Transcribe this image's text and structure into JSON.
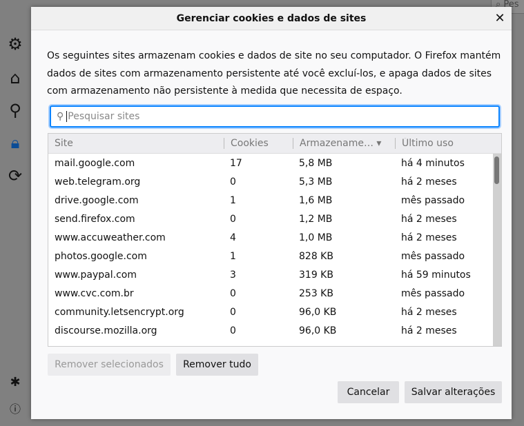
{
  "background": {
    "search_placeholder": "Pes"
  },
  "sidebar": {
    "icons": [
      "gear-icon",
      "home-icon",
      "search-icon",
      "lock-icon",
      "sync-icon",
      "puzzle-icon",
      "help-icon"
    ]
  },
  "dialog": {
    "title": "Gerenciar cookies e dados de sites",
    "close_label": "✕",
    "description": "Os seguintes sites armazenam cookies e dados de site no seu computador. O Firefox mantém dados de sites com armazenamento persistente até você excluí-los, e apaga dados de sites com armazenamento não persistente à medida que necessita de espaço.",
    "search": {
      "placeholder": "Pesquisar sites",
      "value": ""
    },
    "columns": [
      "Site",
      "Cookies",
      "Armazename…",
      "Último uso"
    ],
    "sort_indicator": "▾",
    "rows": [
      [
        "mail.google.com",
        "17",
        "5,8 MB",
        "há 4 minutos"
      ],
      [
        "web.telegram.org",
        "0",
        "5,3 MB",
        "há 2 meses"
      ],
      [
        "drive.google.com",
        "1",
        "1,6 MB",
        "mês passado"
      ],
      [
        "send.firefox.com",
        "0",
        "1,2 MB",
        "há 2 meses"
      ],
      [
        "www.accuweather.com",
        "4",
        "1,0 MB",
        "há 2 meses"
      ],
      [
        "photos.google.com",
        "1",
        "828 KB",
        "mês passado"
      ],
      [
        "www.paypal.com",
        "3",
        "319 KB",
        "há 59 minutos"
      ],
      [
        "www.cvc.com.br",
        "0",
        "253 KB",
        "mês passado"
      ],
      [
        "community.letsencrypt.org",
        "0",
        "96,0 KB",
        "há 2 meses"
      ],
      [
        "discourse.mozilla.org",
        "0",
        "96,0 KB",
        "há 2 meses"
      ]
    ],
    "buttons": {
      "remove_selected": "Remover selecionados",
      "remove_all": "Remover tudo",
      "cancel": "Cancelar",
      "save": "Salvar alterações"
    },
    "accent": "#0a84ff"
  }
}
